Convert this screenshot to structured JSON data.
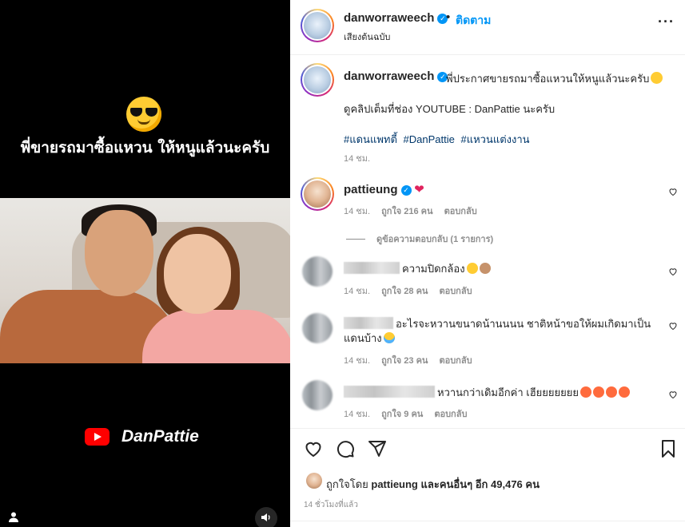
{
  "video": {
    "caption": "พี่ขายรถมาซื้อแหวน ให้หนูแล้วนะครับ",
    "brand": "DanPattie"
  },
  "header": {
    "username": "danworraweech",
    "dot": "•",
    "follow_label": "ติดตาม",
    "audio_label": "เสียงต้นฉบับ",
    "more_icon": "more-horizontal-icon"
  },
  "caption": {
    "username": "danworraweech",
    "text": "พี่ประกาศขายรถมาซื้อแหวนให้หนูแล้วนะครับ",
    "line2": "ดูคลิปเต็มที่ช่อง YOUTUBE : DanPattie นะครับ",
    "hashtags": [
      "#แดนแพทตี้",
      "#DanPattie",
      "#แหวนแต่งงาน"
    ],
    "time": "14 ชม."
  },
  "comments": [
    {
      "username": "pattieung",
      "text": "",
      "time": "14 ชม.",
      "likes": "ถูกใจ 216 คน",
      "reply": "ตอบกลับ",
      "view_replies": "ดูข้อความตอบกลับ (1 รายการ)"
    },
    {
      "username": "",
      "text": "ความปิดกล้อง",
      "time": "14 ชม.",
      "likes": "ถูกใจ 28 คน",
      "reply": "ตอบกลับ"
    },
    {
      "username": "",
      "text": "อะไรจะหวานขนาดน้านนนน ชาติหน้าขอให้ผมเกิดมาเป็น",
      "text2": "แดนบ้าง",
      "time": "14 ชม.",
      "likes": "ถูกใจ 23 คน",
      "reply": "ตอบกลับ"
    },
    {
      "username": "",
      "text": "หวานกว่าเดิมอีกค่า เฮียยยยยยย",
      "time": "14 ชม.",
      "likes": "ถูกใจ 9 คน",
      "reply": "ตอบกลับ"
    }
  ],
  "likes": {
    "prefix": "ถูกใจโดย",
    "user": "pattieung",
    "middle": "และคนอื่นๆ อีก",
    "count": "49,476",
    "suffix": "คน"
  },
  "post_time": "14 ชั่วโมงที่แล้ว",
  "colors": {
    "accent": "#0095f6",
    "hashtag": "#00376b",
    "muted": "#8e8e8e",
    "heart": "#e0245e"
  }
}
